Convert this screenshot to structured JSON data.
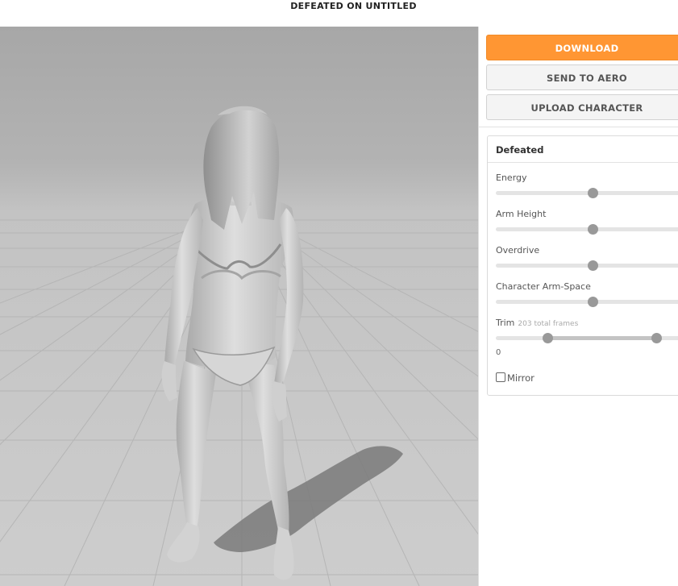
{
  "header": {
    "title": "DEFEATED ON UNTITLED"
  },
  "buttons": {
    "download": "DOWNLOAD",
    "send_to_aero": "SEND TO AERO",
    "upload_character": "UPLOAD CHARACTER"
  },
  "panel": {
    "title": "Defeated",
    "sliders": [
      {
        "label": "Energy",
        "value": 0.5
      },
      {
        "label": "Arm Height",
        "value": 0.5
      },
      {
        "label": "Overdrive",
        "value": 0.5
      },
      {
        "label": "Character Arm-Space",
        "value": 0.5
      }
    ],
    "trim": {
      "label": "Trim",
      "note": "203 total frames",
      "start": 0.27,
      "end": 0.83,
      "value": "0"
    },
    "mirror": {
      "label": "Mirror",
      "checked": false
    }
  },
  "colors": {
    "accent": "#ff9633",
    "viewport_bg": "#c3c3c3",
    "thumb": "#999999"
  }
}
